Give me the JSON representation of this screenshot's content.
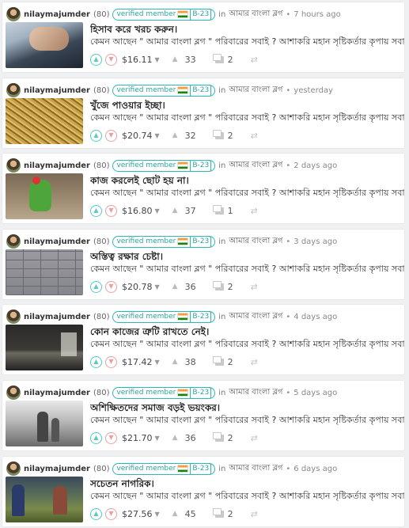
{
  "posts": [
    {
      "author": "nilaymajumder",
      "reputation": "(80)",
      "badge": "verified member",
      "badge_tag": "B-23",
      "in_label": "in",
      "community": "আমার বাংলা ব্লগ",
      "time": "7 hours ago",
      "title": "হিসাব করে খরচ করুন।",
      "snippet": "কেমন আছেন \" আমার বাংলা ব্লগ \" পরিবারের সবাই ? আশাকরি মহান সৃষ্টিকর্তার কৃপায় সবাই ভালো",
      "payout": "$16.11",
      "votes": "33",
      "comments": "2",
      "thumb_icon": "laptop-hands-image"
    },
    {
      "author": "nilaymajumder",
      "reputation": "(80)",
      "badge": "verified member",
      "badge_tag": "B-23",
      "in_label": "in",
      "community": "আমার বাংলা ব্লগ",
      "time": "yesterday",
      "title": "খুঁজে পাওয়ার ইচ্ছা।",
      "snippet": "কেমন আছেন \" আমার বাংলা ব্লগ \" পরিবারের সবাই ? আশাকরি মহান সৃষ্টিকর্তার কৃপায় সবাই ভালো",
      "payout": "$20.74",
      "votes": "32",
      "comments": "2",
      "thumb_icon": "straw-haystack-image"
    },
    {
      "author": "nilaymajumder",
      "reputation": "(80)",
      "badge": "verified member",
      "badge_tag": "B-23",
      "in_label": "in",
      "community": "আমার বাংলা ব্লগ",
      "time": "2 days ago",
      "title": "কাজ করলেই ছোট হয় না।",
      "snippet": "কেমন আছেন \" আমার বাংলা ব্লগ \" পরিবারের সবাই ? আশাকরি মহান সৃষ্টিকর্তার কৃপায় সবাই ভালো",
      "payout": "$16.80",
      "votes": "37",
      "comments": "1",
      "thumb_icon": "frog-toy-image"
    },
    {
      "author": "nilaymajumder",
      "reputation": "(80)",
      "badge": "verified member",
      "badge_tag": "B-23",
      "in_label": "in",
      "community": "আমার বাংলা ব্লগ",
      "time": "3 days ago",
      "title": "অস্তিত্ব রক্ষার চেষ্টা।",
      "snippet": "কেমন আছেন \" আমার বাংলা ব্লগ \" পরিবারের সবাই ? আশাকরি মহান সৃষ্টিকর্তার কৃপায় সবাই ভালো",
      "payout": "$20.78",
      "votes": "36",
      "comments": "2",
      "thumb_icon": "stone-wall-image"
    },
    {
      "author": "nilaymajumder",
      "reputation": "(80)",
      "badge": "verified member",
      "badge_tag": "B-23",
      "in_label": "in",
      "community": "আমার বাংলা ব্লগ",
      "time": "4 days ago",
      "title": "কোন কাজের ত্রুটি রাখতে নেই।",
      "snippet": "কেমন আছেন \" আমার বাংলা ব্লগ \" পরিবারের সবাই ? আশাকরি মহান সৃষ্টিকর্তার কৃপায় সবাই ভালো",
      "payout": "$17.42",
      "votes": "38",
      "comments": "2",
      "thumb_icon": "dark-room-image"
    },
    {
      "author": "nilaymajumder",
      "reputation": "(80)",
      "badge": "verified member",
      "badge_tag": "B-23",
      "in_label": "in",
      "community": "আমার বাংলা ব্লগ",
      "time": "5 days ago",
      "title": "অশিক্ষিতদের সমাজ বড়ই ভয়ংকর।",
      "snippet": "কেমন আছেন \" আমার বাংলা ব্লগ \" পরিবারের সবাই ? আশাকরি মহান সৃষ্টিকর্তার কৃপায় সবাই ভালো",
      "payout": "$21.70",
      "votes": "36",
      "comments": "2",
      "thumb_icon": "people-walking-image"
    },
    {
      "author": "nilaymajumder",
      "reputation": "(80)",
      "badge": "verified member",
      "badge_tag": "B-23",
      "in_label": "in",
      "community": "আমার বাংলা ব্লগ",
      "time": "6 days ago",
      "title": "সচেতন নাগরিক।",
      "snippet": "কেমন আছেন \" আমার বাংলা ব্লগ \" পরিবারের সবাই ? আশাকরি মহান সৃষ্টিকর্তার কৃপায় সবাই ভালো",
      "payout": "$27.56",
      "votes": "45",
      "comments": "2",
      "thumb_icon": "market-crowd-image"
    }
  ]
}
